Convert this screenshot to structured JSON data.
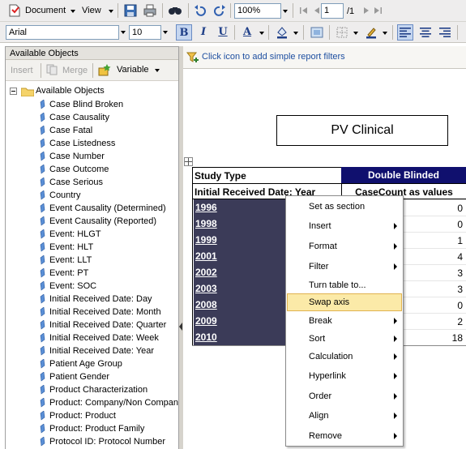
{
  "toolbar": {
    "document_label": "Document",
    "view_label": "View",
    "zoom_value": "100%",
    "page_value": "1",
    "page_total": "/1",
    "font_value": "Arial",
    "font_size_value": "10",
    "bold_label": "B",
    "italic_label": "I",
    "underline_label": "U",
    "font_color_label": "A"
  },
  "left_panel": {
    "title": "Available Objects",
    "insert_label": "Insert",
    "merge_label": "Merge",
    "variable_label": "Variable",
    "root_label": "Available Objects",
    "items": [
      "Case Blind Broken",
      "Case Causality",
      "Case Fatal",
      "Case Listedness",
      "Case Number",
      "Case Outcome",
      "Case Serious",
      "Country",
      "Event Causality (Determined)",
      "Event Causality (Reported)",
      "Event: HLGT",
      "Event: HLT",
      "Event: LLT",
      "Event: PT",
      "Event: SOC",
      "Initial Received Date: Day",
      "Initial Received Date: Month",
      "Initial Received Date: Quarter",
      "Initial Received Date: Week",
      "Initial Received Date: Year",
      "Patient Age Group",
      "Patient Gender",
      "Product Characterization",
      "Product: Company/Non Company",
      "Product: Product",
      "Product: Product Family",
      "Protocol ID: Protocol Number"
    ]
  },
  "filter_bar": {
    "text": "Click icon to add simple report filters"
  },
  "report": {
    "title": "PV Clinical",
    "study_type_label": "Study Type",
    "study_type_value": "Double Blinded",
    "year_header": "Initial Received Date: Year",
    "count_header": "CaseCount as values",
    "rows": [
      {
        "year": "1996",
        "count": "0"
      },
      {
        "year": "1998",
        "count": "0"
      },
      {
        "year": "1999",
        "count": "1"
      },
      {
        "year": "2001",
        "count": "4"
      },
      {
        "year": "2002",
        "count": "3"
      },
      {
        "year": "2003",
        "count": "3"
      },
      {
        "year": "2008",
        "count": "0"
      },
      {
        "year": "2009",
        "count": "2"
      },
      {
        "year": "2010",
        "count": "18"
      }
    ]
  },
  "context_menu": {
    "items": [
      {
        "label": "Set as section",
        "submenu": false
      },
      {
        "label": "Insert",
        "submenu": true
      },
      {
        "label": "Format",
        "submenu": true
      },
      {
        "label": "Filter",
        "submenu": true
      },
      {
        "label": "Turn table to...",
        "submenu": false
      },
      {
        "label": "Swap axis",
        "submenu": false,
        "highlighted": true
      },
      {
        "label": "Break",
        "submenu": true
      },
      {
        "label": "Sort",
        "submenu": true
      },
      {
        "label": "Calculation",
        "submenu": true
      },
      {
        "label": "Hyperlink",
        "submenu": true
      },
      {
        "label": "Order",
        "submenu": true
      },
      {
        "label": "Align",
        "submenu": true
      },
      {
        "label": "Remove",
        "submenu": true
      }
    ]
  },
  "colors": {
    "year_cell_bg": "#3b3b58",
    "header_bg": "#10106e",
    "menu_highlight": "#fbeaa8",
    "link_blue": "#1e4fa0"
  }
}
